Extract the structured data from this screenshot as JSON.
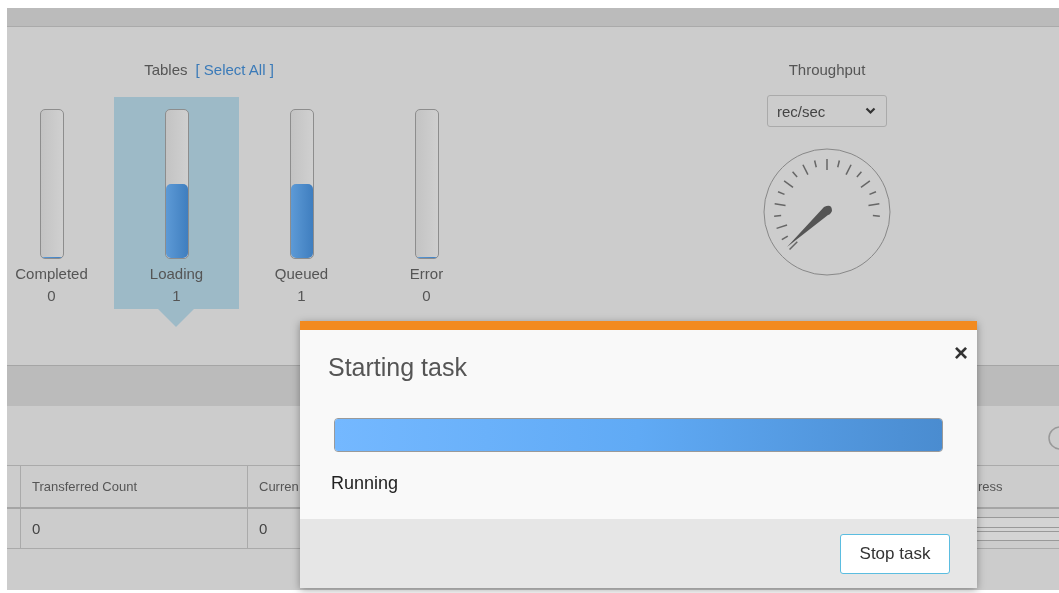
{
  "tables_panel": {
    "label": "Tables",
    "select_all": "[ Select All ]",
    "statuses": [
      {
        "label": "Completed",
        "count": "0",
        "level": 0,
        "selected": false
      },
      {
        "label": "Loading",
        "count": "1",
        "level": 0.5,
        "selected": true
      },
      {
        "label": "Queued",
        "count": "1",
        "level": 0.5,
        "selected": false
      },
      {
        "label": "Error",
        "count": "0",
        "level": 0,
        "selected": false
      }
    ]
  },
  "throughput": {
    "label": "Throughput",
    "unit": "rec/sec"
  },
  "table": {
    "columns": [
      "Transferred Count",
      "Curren"
    ],
    "rows": [
      [
        "0",
        "0"
      ]
    ],
    "progress_column": {
      "label": "ress"
    }
  },
  "dialog": {
    "title": "Starting task",
    "close": "×",
    "progress": {
      "level": 1
    },
    "status": "Running",
    "buttons": [
      "Stop task"
    ]
  }
}
